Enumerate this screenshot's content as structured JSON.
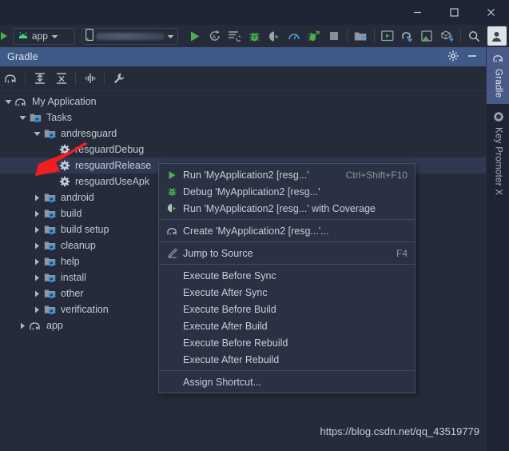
{
  "window": {
    "controls": [
      {
        "name": "minimize-button",
        "icon": "minimize-icon",
        "label": "—"
      },
      {
        "name": "maximize-button",
        "icon": "maximize-icon",
        "label": "□"
      },
      {
        "name": "close-button",
        "icon": "close-icon",
        "label": "✕"
      }
    ]
  },
  "toolbar": {
    "run_config": {
      "label": "app",
      "icon": "android-icon",
      "dropdown": "chevron-down-icon"
    },
    "device_selector": {
      "value": "",
      "icon": "device-phone-icon",
      "dropdown": "chevron-down-icon"
    },
    "buttons": [
      {
        "name": "run-button",
        "icon": "run-icon"
      },
      {
        "name": "apply-changes-button",
        "icon": "apply-changes-icon"
      },
      {
        "name": "apply-code-changes-button",
        "icon": "apply-code-changes-icon"
      },
      {
        "name": "debug-button",
        "icon": "debug-icon"
      },
      {
        "name": "run-with-coverage-button",
        "icon": "coverage-icon"
      },
      {
        "name": "profiler-button",
        "icon": "profiler-icon"
      },
      {
        "name": "attach-debugger-button",
        "icon": "attach-debugger-icon"
      },
      {
        "name": "stop-button",
        "icon": "stop-icon"
      },
      {
        "name": "sdk-manager-button",
        "icon": "sdk-manager-icon"
      },
      {
        "name": "avd-manager-button",
        "icon": "avd-manager-icon"
      },
      {
        "name": "sync-gradle-button",
        "icon": "gradle-sync-icon"
      },
      {
        "name": "layout-inspector-button",
        "icon": "layout-inspector-icon"
      },
      {
        "name": "apk-analyzer-button",
        "icon": "apk-download-icon"
      },
      {
        "name": "search-everywhere-button",
        "icon": "search-icon"
      },
      {
        "name": "account-button",
        "icon": "avatar-icon"
      }
    ]
  },
  "tool_window": {
    "title": "Gradle",
    "header_actions": [
      {
        "name": "settings-button",
        "icon": "gear-icon"
      },
      {
        "name": "hide-button",
        "icon": "minimize-icon"
      }
    ],
    "panel_actions": [
      {
        "name": "sync-all-gradle-projects-button",
        "icon": "gradle-elephant-icon"
      },
      {
        "name": "expand-all-button",
        "icon": "expand-all-icon"
      },
      {
        "name": "collapse-all-button",
        "icon": "collapse-all-icon"
      },
      {
        "name": "toggle-offline-mode-button",
        "icon": "offline-mode-icon"
      },
      {
        "name": "gradle-settings-button",
        "icon": "wrench-icon"
      }
    ]
  },
  "tree": {
    "nodes": [
      {
        "label": "My Application",
        "icon": "gradle-elephant-icon",
        "indent": 0,
        "twisty": "expanded",
        "selected": false
      },
      {
        "label": "Tasks",
        "icon": "task-group-folder-icon",
        "indent": 1,
        "twisty": "expanded",
        "selected": false
      },
      {
        "label": "andresguard",
        "icon": "task-group-folder-icon",
        "indent": 2,
        "twisty": "expanded",
        "selected": false
      },
      {
        "label": "resguardDebug",
        "icon": "gear-task-icon",
        "indent": 3,
        "twisty": "none",
        "selected": false
      },
      {
        "label": "resguardRelease",
        "icon": "gear-task-icon",
        "indent": 3,
        "twisty": "none",
        "selected": true
      },
      {
        "label": "resguardUseApk",
        "icon": "gear-task-icon",
        "indent": 3,
        "twisty": "none",
        "selected": false
      },
      {
        "label": "android",
        "icon": "task-group-folder-icon",
        "indent": 2,
        "twisty": "collapsed",
        "selected": false
      },
      {
        "label": "build",
        "icon": "task-group-folder-icon",
        "indent": 2,
        "twisty": "collapsed",
        "selected": false
      },
      {
        "label": "build setup",
        "icon": "task-group-folder-icon",
        "indent": 2,
        "twisty": "collapsed",
        "selected": false
      },
      {
        "label": "cleanup",
        "icon": "task-group-folder-icon",
        "indent": 2,
        "twisty": "collapsed",
        "selected": false
      },
      {
        "label": "help",
        "icon": "task-group-folder-icon",
        "indent": 2,
        "twisty": "collapsed",
        "selected": false
      },
      {
        "label": "install",
        "icon": "task-group-folder-icon",
        "indent": 2,
        "twisty": "collapsed",
        "selected": false
      },
      {
        "label": "other",
        "icon": "task-group-folder-icon",
        "indent": 2,
        "twisty": "collapsed",
        "selected": false
      },
      {
        "label": "verification",
        "icon": "task-group-folder-icon",
        "indent": 2,
        "twisty": "collapsed",
        "selected": false
      },
      {
        "label": "app",
        "icon": "gradle-elephant-icon",
        "indent": 1,
        "twisty": "collapsed",
        "selected": false
      }
    ]
  },
  "context_menu": {
    "items": [
      {
        "label": "Run 'MyApplication2 [resg...'",
        "shortcut": "Ctrl+Shift+F10",
        "icon": "run-icon",
        "name": "menu-item-run"
      },
      {
        "label": "Debug 'MyApplication2 [resg...'",
        "shortcut": "",
        "icon": "debug-icon",
        "name": "menu-item-debug"
      },
      {
        "label": "Run 'MyApplication2 [resg...' with Coverage",
        "shortcut": "",
        "icon": "coverage-icon",
        "name": "menu-item-run-with-coverage"
      },
      {
        "separator": true
      },
      {
        "label": "Create 'MyApplication2 [resg...'...",
        "shortcut": "",
        "icon": "gradle-elephant-icon",
        "name": "menu-item-create"
      },
      {
        "separator": true
      },
      {
        "label": "Jump to Source",
        "shortcut": "F4",
        "icon": "edit-pencil-icon",
        "name": "menu-item-jump-to-source"
      },
      {
        "separator": true
      },
      {
        "label": "Execute Before Sync",
        "shortcut": "",
        "icon": "",
        "name": "menu-item-execute-before-sync"
      },
      {
        "label": "Execute After Sync",
        "shortcut": "",
        "icon": "",
        "name": "menu-item-execute-after-sync"
      },
      {
        "label": "Execute Before Build",
        "shortcut": "",
        "icon": "",
        "name": "menu-item-execute-before-build"
      },
      {
        "label": "Execute After Build",
        "shortcut": "",
        "icon": "",
        "name": "menu-item-execute-after-build"
      },
      {
        "label": "Execute Before Rebuild",
        "shortcut": "",
        "icon": "",
        "name": "menu-item-execute-before-rebuild"
      },
      {
        "label": "Execute After Rebuild",
        "shortcut": "",
        "icon": "",
        "name": "menu-item-execute-after-rebuild"
      },
      {
        "separator": true
      },
      {
        "label": "Assign Shortcut...",
        "shortcut": "",
        "icon": "",
        "name": "menu-item-assign-shortcut"
      }
    ]
  },
  "right_strip": {
    "tabs": [
      {
        "label": "Gradle",
        "icon": "gradle-elephant-icon",
        "active": true
      },
      {
        "label": "Key Promoter X",
        "icon": "key-promoter-icon",
        "active": false
      }
    ]
  },
  "annotations": {
    "arrow_color": "#f01e1e"
  },
  "watermark": {
    "text": "https://blog.csdn.net/qq_43519779"
  },
  "colors": {
    "background": "#252b38",
    "titlebar": "#1e2433",
    "tool_window_header": "#3f5a87",
    "selection": "#2f3a52",
    "menu_background": "#2a3142",
    "accent_green": "#4caf50",
    "folder_blue": "#3d8fd1",
    "text": "#c2c8d2"
  }
}
